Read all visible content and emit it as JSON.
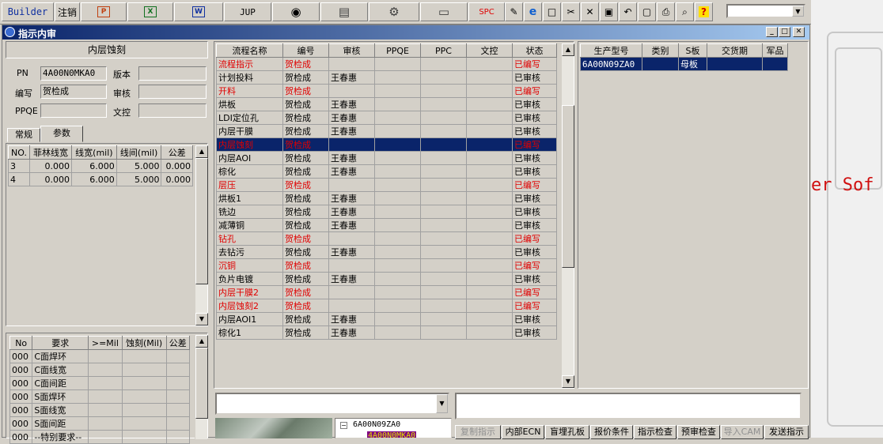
{
  "toolbar": {
    "builder_label": "Builder",
    "logout_label": "注销",
    "jup_label": "JUP",
    "spc_label": "SPC",
    "buttons": [
      {
        "icon": "ppt-icon",
        "glyph": "P",
        "color": "#c04010"
      },
      {
        "icon": "excel-icon",
        "glyph": "X",
        "color": "#107020"
      },
      {
        "icon": "word-icon",
        "glyph": "W",
        "color": "#1030a0"
      },
      {
        "icon": "eye-icon",
        "glyph": "◉",
        "color": "#000000"
      },
      {
        "icon": "database-icon",
        "glyph": "▤",
        "color": "#404040"
      },
      {
        "icon": "settings-icon",
        "glyph": "⚙",
        "color": "#404040"
      },
      {
        "icon": "computer-icon",
        "glyph": "▭",
        "color": "#404040"
      }
    ],
    "small_buttons": [
      {
        "icon": "notepad-icon",
        "glyph": "✎"
      },
      {
        "icon": "ie-icon",
        "glyph": "e"
      },
      {
        "icon": "new-file-icon",
        "glyph": "□"
      },
      {
        "icon": "cut-icon",
        "glyph": "✂"
      },
      {
        "icon": "close-x-icon",
        "glyph": "✕"
      },
      {
        "icon": "save-icon",
        "glyph": "▣"
      },
      {
        "icon": "undo-icon",
        "glyph": "↶"
      },
      {
        "icon": "paste-icon",
        "glyph": "▢"
      },
      {
        "icon": "print-icon",
        "glyph": "⎙"
      },
      {
        "icon": "binoculars-icon",
        "glyph": "⌕"
      },
      {
        "icon": "help-icon",
        "glyph": "?"
      }
    ]
  },
  "background_text": "er Sof",
  "window": {
    "title": "指示内审"
  },
  "left_panel": {
    "header": "内层蚀刻",
    "pn_label": "PN",
    "pn_value": "4A00N0MKA0",
    "version_label": "版本",
    "version_value": "",
    "author_label": "编写",
    "author_value": "贺检成",
    "review_label": "审核",
    "review_value": "",
    "ppqe_label": "PPQE",
    "ppqe_value": "",
    "doc_label": "文控",
    "doc_value": "",
    "tabs": [
      "常规",
      "参数"
    ],
    "params_columns": [
      "NO.",
      "菲林线宽",
      "线宽(mil)",
      "线间(mil)",
      "公差"
    ],
    "params_rows": [
      [
        "3",
        "0.000",
        "6.000",
        "5.000",
        "0.000"
      ],
      [
        "4",
        "0.000",
        "6.000",
        "5.000",
        "0.000"
      ]
    ],
    "req_columns": [
      "No",
      "要求",
      ">=Mil",
      "蚀刻(Mil)",
      "公差"
    ],
    "req_rows": [
      [
        "000",
        "C面焊环"
      ],
      [
        "000",
        "C面线宽"
      ],
      [
        "000",
        "C面间距"
      ],
      [
        "000",
        "S面焊环"
      ],
      [
        "000",
        "S面线宽"
      ],
      [
        "000",
        "S面间距"
      ],
      [
        "000",
        "--特别要求--"
      ]
    ]
  },
  "process_table": {
    "columns": [
      "流程名称",
      "编号",
      "审核",
      "PPQE",
      "PPC",
      "文控",
      "状态"
    ],
    "rows": [
      {
        "name": "流程指示",
        "code": "贺检成",
        "review": "",
        "status": "已编写",
        "red": true
      },
      {
        "name": "计划投料",
        "code": "贺检成",
        "review": "王春惠",
        "status": "已审核",
        "red": false
      },
      {
        "name": "开料",
        "code": "贺检成",
        "review": "",
        "status": "已编写",
        "red": true
      },
      {
        "name": "烘板",
        "code": "贺检成",
        "review": "王春惠",
        "status": "已审核",
        "red": false
      },
      {
        "name": "LDI定位孔",
        "code": "贺检成",
        "review": "王春惠",
        "status": "已审核",
        "red": false
      },
      {
        "name": "内层干膜",
        "code": "贺检成",
        "review": "王春惠",
        "status": "已审核",
        "red": false
      },
      {
        "name": "内层蚀刻",
        "code": "贺检成",
        "review": "",
        "status": "已编写",
        "red": true,
        "selected": true
      },
      {
        "name": "内层AOI",
        "code": "贺检成",
        "review": "王春惠",
        "status": "已审核",
        "red": false
      },
      {
        "name": "棕化",
        "code": "贺检成",
        "review": "王春惠",
        "status": "已审核",
        "red": false
      },
      {
        "name": "层压",
        "code": "贺检成",
        "review": "",
        "status": "已编写",
        "red": true
      },
      {
        "name": "烘板1",
        "code": "贺检成",
        "review": "王春惠",
        "status": "已审核",
        "red": false
      },
      {
        "name": "铣边",
        "code": "贺检成",
        "review": "王春惠",
        "status": "已审核",
        "red": false
      },
      {
        "name": "减薄铜",
        "code": "贺检成",
        "review": "王春惠",
        "status": "已审核",
        "red": false
      },
      {
        "name": "钻孔",
        "code": "贺检成",
        "review": "",
        "status": "已编写",
        "red": true
      },
      {
        "name": "去钻污",
        "code": "贺检成",
        "review": "王春惠",
        "status": "已审核",
        "red": false
      },
      {
        "name": "沉铜",
        "code": "贺检成",
        "review": "",
        "status": "已编写",
        "red": true
      },
      {
        "name": "负片电镀",
        "code": "贺检成",
        "review": "王春惠",
        "status": "已审核",
        "red": false
      },
      {
        "name": "内层干膜2",
        "code": "贺检成",
        "review": "",
        "status": "已编写",
        "red": true
      },
      {
        "name": "内层蚀刻2",
        "code": "贺检成",
        "review": "",
        "status": "已编写",
        "red": true
      },
      {
        "name": "内层AOI1",
        "code": "贺检成",
        "review": "王春惠",
        "status": "已审核",
        "red": false
      },
      {
        "name": "棕化1",
        "code": "贺检成",
        "review": "王春惠",
        "status": "已审核",
        "red": false
      }
    ]
  },
  "product_table": {
    "columns": [
      "生产型号",
      "类别",
      "S板",
      "交货期",
      "军品"
    ],
    "rows": [
      [
        "6A00N09ZA0",
        "",
        "母板",
        "",
        ""
      ]
    ]
  },
  "tree": {
    "root": "6A00N09ZA0",
    "child": "4A00N0MKA0"
  },
  "bottom_buttons": [
    {
      "label": "复制指示",
      "disabled": true
    },
    {
      "label": "内部ECN",
      "disabled": false
    },
    {
      "label": "盲埋孔板",
      "disabled": false
    },
    {
      "label": "报价条件",
      "disabled": false
    },
    {
      "label": "指示检查",
      "disabled": false
    },
    {
      "label": "预审检查",
      "disabled": false
    },
    {
      "label": "导入CAM",
      "disabled": true
    },
    {
      "label": "发送指示",
      "disabled": false
    }
  ]
}
